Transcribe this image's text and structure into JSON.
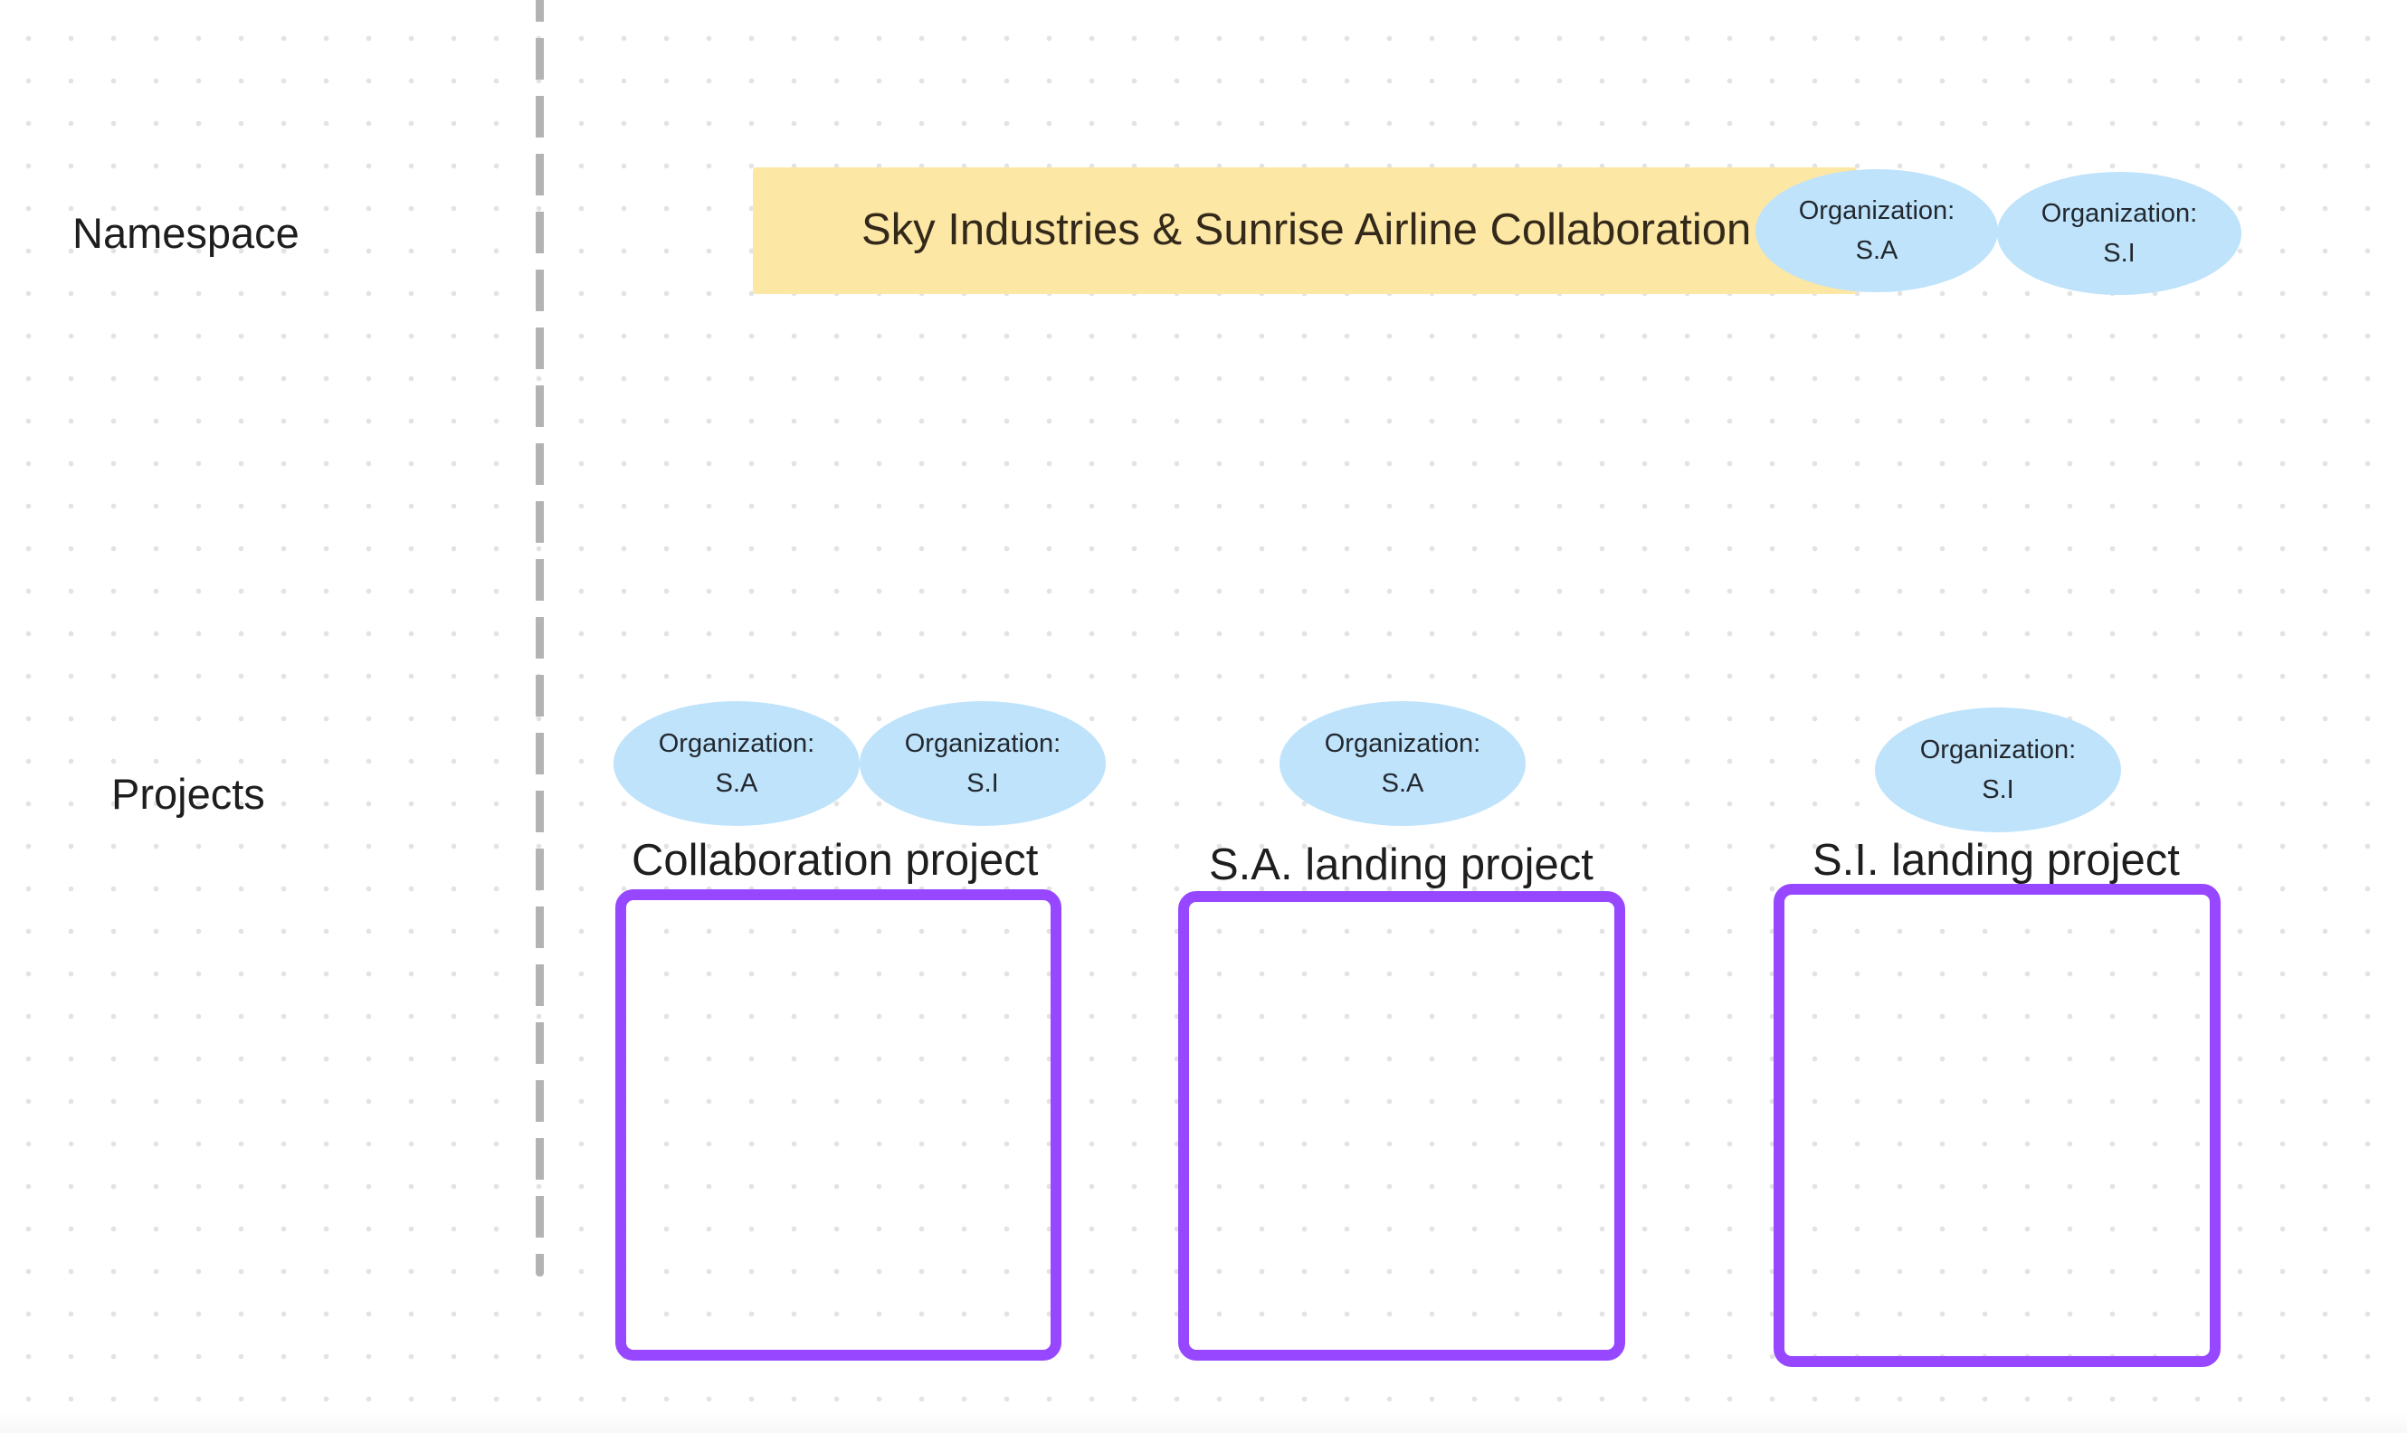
{
  "row_labels": {
    "namespace": "Namespace",
    "projects": "Projects"
  },
  "namespace": {
    "title": "Sky Industries & Sunrise Airline Collaboration",
    "color": "#fde7a5",
    "organizations": [
      {
        "line1": "Organization:",
        "line2": "S.A"
      },
      {
        "line1": "Organization:",
        "line2": "S.I"
      }
    ]
  },
  "projects": [
    {
      "title": "Collaboration project",
      "organizations": [
        {
          "line1": "Organization:",
          "line2": "S.A"
        },
        {
          "line1": "Organization:",
          "line2": "S.I"
        }
      ]
    },
    {
      "title": "S.A. landing project",
      "organizations": [
        {
          "line1": "Organization:",
          "line2": "S.A"
        }
      ]
    },
    {
      "title": "S.I. landing project",
      "organizations": [
        {
          "line1": "Organization:",
          "line2": "S.I"
        }
      ]
    }
  ],
  "colors": {
    "organization_fill": "#bee3fb",
    "project_frame": "#9747ff",
    "divider": "#b3b3b3"
  }
}
